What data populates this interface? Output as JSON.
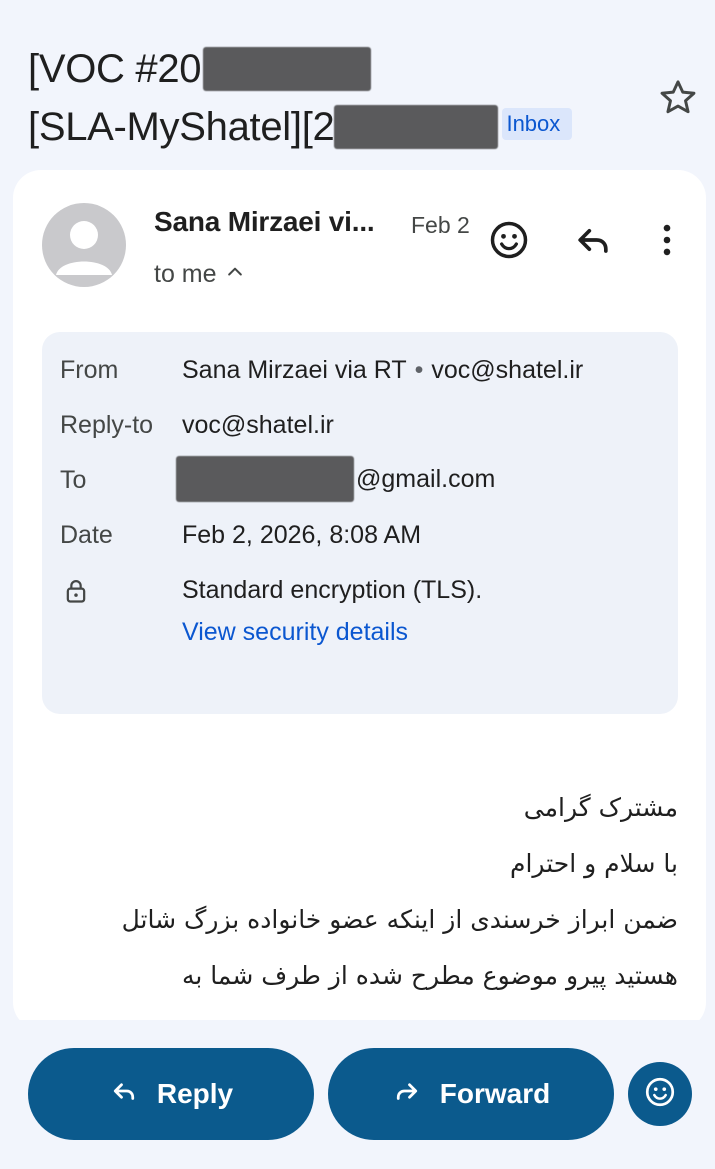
{
  "subject": {
    "line1_prefix": "[VOC #20",
    "line2_prefix": "[SLA-MyShatel][2",
    "label_chip": "Inbox"
  },
  "message": {
    "sender": "Sana Mirzaei vi...",
    "date_short": "Feb 2",
    "recipient_summary": "to me"
  },
  "details": {
    "from_label": "From",
    "from_name": "Sana Mirzaei via RT",
    "from_separator": "•",
    "from_email": "voc@shatel.ir",
    "replyto_label": "Reply-to",
    "replyto_value": "voc@shatel.ir",
    "to_label": "To",
    "to_value_suffix": "@gmail.com",
    "date_label": "Date",
    "date_value": "Feb 2, 2026, 8:08 AM",
    "security_text": "Standard encryption (TLS).",
    "security_link": "View security details"
  },
  "body": {
    "lines": [
      "مشترک گرامی",
      "با سلام و احترام",
      "ضمن ابراز خرسندی از اینکه عضو خانواده بزرگ شاتل",
      "هستید پیرو موضوع مطرح شده از طرف شما به"
    ]
  },
  "actions": {
    "reply_label": "Reply",
    "forward_label": "Forward"
  },
  "colors": {
    "accent": "#0b57d0",
    "button_bg": "#0b5a8d",
    "chip_bg": "#dbe6fb",
    "page_bg": "#f2f5fc",
    "details_bg": "#eef2f9"
  }
}
